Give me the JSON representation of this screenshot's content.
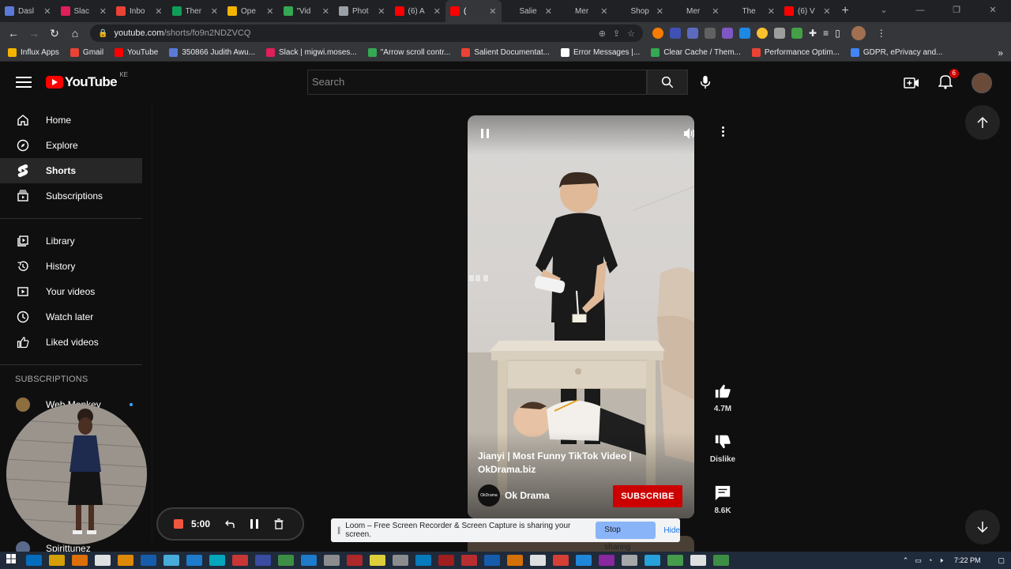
{
  "browser": {
    "tabs": [
      {
        "title": "Dasl",
        "color": "#5b7ad8"
      },
      {
        "title": "Slac",
        "color": "#e01e5a"
      },
      {
        "title": "Inbo",
        "color": "#ea4335"
      },
      {
        "title": "Ther",
        "color": "#0f9d58"
      },
      {
        "title": "Ope",
        "color": "#f4b400"
      },
      {
        "title": "\"Vid",
        "color": "#34a853"
      },
      {
        "title": "Phot",
        "color": "#9aa0a6"
      },
      {
        "title": "(6) A",
        "color": "#ff0000"
      },
      {
        "title": "(",
        "color": "#ff0000"
      },
      {
        "title": "Salie",
        "color": "#202124"
      },
      {
        "title": "Mer",
        "color": "#202124"
      },
      {
        "title": "Shop",
        "color": "#202124"
      },
      {
        "title": "Mer",
        "color": "#202124"
      },
      {
        "title": "The",
        "color": "#202124"
      },
      {
        "title": "(6) V",
        "color": "#ff0000"
      }
    ],
    "active_tab_index": 8,
    "new_tab_label": "+",
    "url_host": "youtube.com",
    "url_path": "/shorts/fo9n2NDZVCQ",
    "bookmarks": [
      {
        "label": "Influx Apps",
        "color": "#f4b400"
      },
      {
        "label": "Gmail",
        "color": "#ea4335"
      },
      {
        "label": "YouTube",
        "color": "#ff0000"
      },
      {
        "label": "350866 Judith Awu...",
        "color": "#5b7ad8"
      },
      {
        "label": "Slack | migwi.moses...",
        "color": "#e01e5a"
      },
      {
        "label": "\"Arrow scroll contr...",
        "color": "#34a853"
      },
      {
        "label": "Salient Documentat...",
        "color": "#ea4335"
      },
      {
        "label": "Error Messages |...",
        "color": "#ffffff"
      },
      {
        "label": "Clear Cache / Them...",
        "color": "#34a853"
      },
      {
        "label": "Performance Optim...",
        "color": "#ea4335"
      },
      {
        "label": "GDPR, ePrivacy and...",
        "color": "#4285f4"
      }
    ]
  },
  "youtube": {
    "logo_text": "YouTube",
    "country_code": "KE",
    "search_placeholder": "Search",
    "notification_count": "6",
    "sidebar": {
      "primary": [
        {
          "label": "Home",
          "icon": "home-icon"
        },
        {
          "label": "Explore",
          "icon": "compass-icon"
        },
        {
          "label": "Shorts",
          "icon": "shorts-icon"
        },
        {
          "label": "Subscriptions",
          "icon": "subscriptions-icon"
        }
      ],
      "secondary": [
        {
          "label": "Library",
          "icon": "library-icon"
        },
        {
          "label": "History",
          "icon": "history-icon"
        },
        {
          "label": "Your videos",
          "icon": "your-videos-icon"
        },
        {
          "label": "Watch later",
          "icon": "clock-icon"
        },
        {
          "label": "Liked videos",
          "icon": "thumbs-up-icon"
        }
      ],
      "subscriptions_heading": "SUBSCRIPTIONS",
      "subscriptions": [
        {
          "label": "Web Monkey"
        },
        {
          "label": "Spirittunez"
        }
      ]
    },
    "short": {
      "title": "Jianyi | Most Funny TikTok Video | OkDrama.biz",
      "channel": "Ok Drama",
      "channel_avatar_text": "OkDrama",
      "subscribe_label": "SUBSCRIBE",
      "likes": "4.7M",
      "dislike_label": "Dislike",
      "comments": "8.6K"
    }
  },
  "loom": {
    "timer": "5:00",
    "share_message": "Loom – Free Screen Recorder & Screen Capture is sharing your screen.",
    "stop_label": "Stop sharing",
    "hide_label": "Hide"
  },
  "taskbar": {
    "clock": "7:22 PM",
    "apps": [
      "#0078d4",
      "#f4b400",
      "#ff7a00",
      "#ffffff",
      "#ff9a00",
      "#1565c0",
      "#4fc3f7",
      "#1e88e5",
      "#00bcd4",
      "#e53935",
      "#3f51b5",
      "#43a047",
      "#1e88e5",
      "#9e9e9e",
      "#c62828",
      "#ffeb3b",
      "#9e9e9e",
      "#0288d1",
      "#b71c1c",
      "#d32f2f",
      "#1565c0",
      "#f57c00",
      "#ffffff",
      "#f44336",
      "#2196f3",
      "#9c27b0",
      "#bdbdbd",
      "#29b6f6",
      "#4caf50",
      "#ffffff",
      "#43a047"
    ]
  }
}
